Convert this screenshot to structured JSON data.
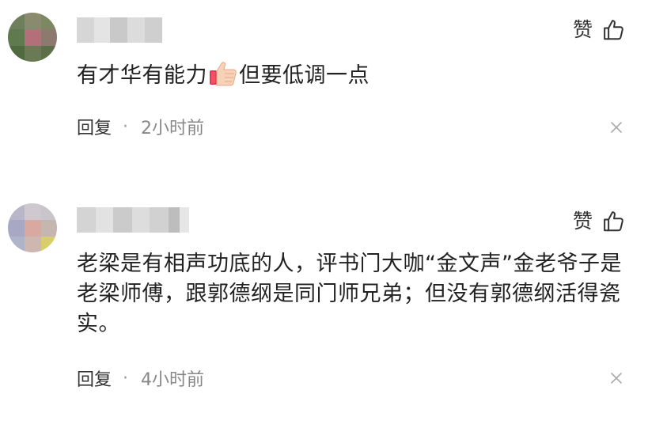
{
  "comments": [
    {
      "like_label": "赞",
      "text_before_emoji": "有才华有能力",
      "text_after_emoji": "但要低调一点",
      "emoji_icon": "thumbs-up-emoji",
      "reply_label": "回复",
      "separator": "·",
      "time": "2小时前",
      "close_glyph": "×"
    },
    {
      "like_label": "赞",
      "text": "老梁是有相声功底的人，评书门大咖“金文声”金老爷子是老梁师傅，跟郭德纲是同门师兄弟；但没有郭德纲活得瓷实。",
      "reply_label": "回复",
      "separator": "·",
      "time": "4小时前",
      "close_glyph": "×"
    }
  ],
  "colors": {
    "text": "#222222",
    "meta": "#333333",
    "time": "#888888",
    "close": "#aaaaaa"
  }
}
